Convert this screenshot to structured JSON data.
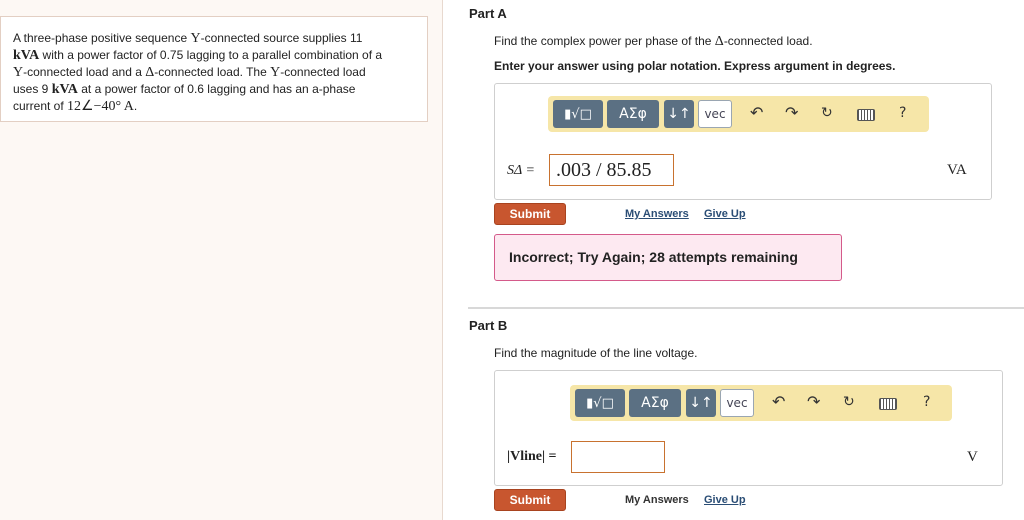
{
  "problem": {
    "t1": "A three-phase positive sequence ",
    "Y": "Y",
    "t2": "-connected source supplies 11",
    "kVA": "kVA",
    "t3": " with a power factor of 0.75 lagging to a parallel combination of a",
    "Y2": "Y",
    "t4": "-connected load and a ",
    "delta": "Δ",
    "t5": "-connected load. The ",
    "Y3": "Y",
    "t6": "-connected load",
    "t7": "uses 9 ",
    "kVA2": "kVA",
    "t8": " at a power factor of 0.6 lagging and has an a-phase",
    "t9": "current of ",
    "current": "12∠−40° A",
    "t10": "."
  },
  "partA": {
    "title": "Part A",
    "prompt_pre": "Find the complex power per phase of the ",
    "prompt_delta": "Δ",
    "prompt_post": "-connected load.",
    "instruction": "Enter your answer using polar notation. Express argument in degrees.",
    "toolbar": {
      "templates_icon": "templates-icon",
      "greek": "ΑΣφ",
      "arrows": "↓↑",
      "vec": "vec",
      "undo_icon": "undo-icon",
      "redo_icon": "redo-icon",
      "reset_icon": "reset-icon",
      "keyboard_icon": "keyboard-icon",
      "help": "?"
    },
    "answer_label": "SΔ =",
    "answer_value": ".003 / 85.85",
    "unit": "VA",
    "submit": "Submit",
    "my_answers": "My Answers",
    "give_up": "Give Up",
    "feedback": "Incorrect; Try Again; 28 attempts remaining"
  },
  "partB": {
    "title": "Part B",
    "prompt": "Find the magnitude of the line voltage.",
    "toolbar": {
      "greek": "ΑΣφ",
      "arrows": "↓↑",
      "vec": "vec",
      "help": "?"
    },
    "answer_label": "|Vline| =",
    "answer_value": "",
    "unit": "V",
    "submit": "Submit",
    "my_answers": "My Answers",
    "give_up": "Give Up"
  },
  "colors": {
    "toolbar_bg": "#f6e6a8",
    "button_dark": "#5b7083",
    "submit": "#c8562f",
    "feedback_bg": "#fde9f1",
    "feedback_border": "#d45a8a"
  }
}
